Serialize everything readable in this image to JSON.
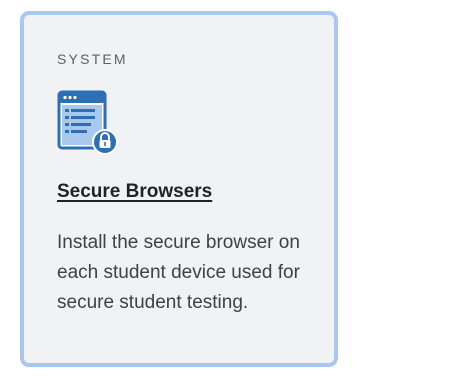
{
  "card": {
    "category": "SYSTEM",
    "icon": "secure-browser-icon",
    "title": "Secure Browsers",
    "description": "Install the secure browser on each student device used for secure student testing."
  },
  "colors": {
    "border": "#a9c8ee",
    "background": "#f0f2f4",
    "icon_primary": "#2c6fb5",
    "icon_light": "#a9c8ee"
  }
}
